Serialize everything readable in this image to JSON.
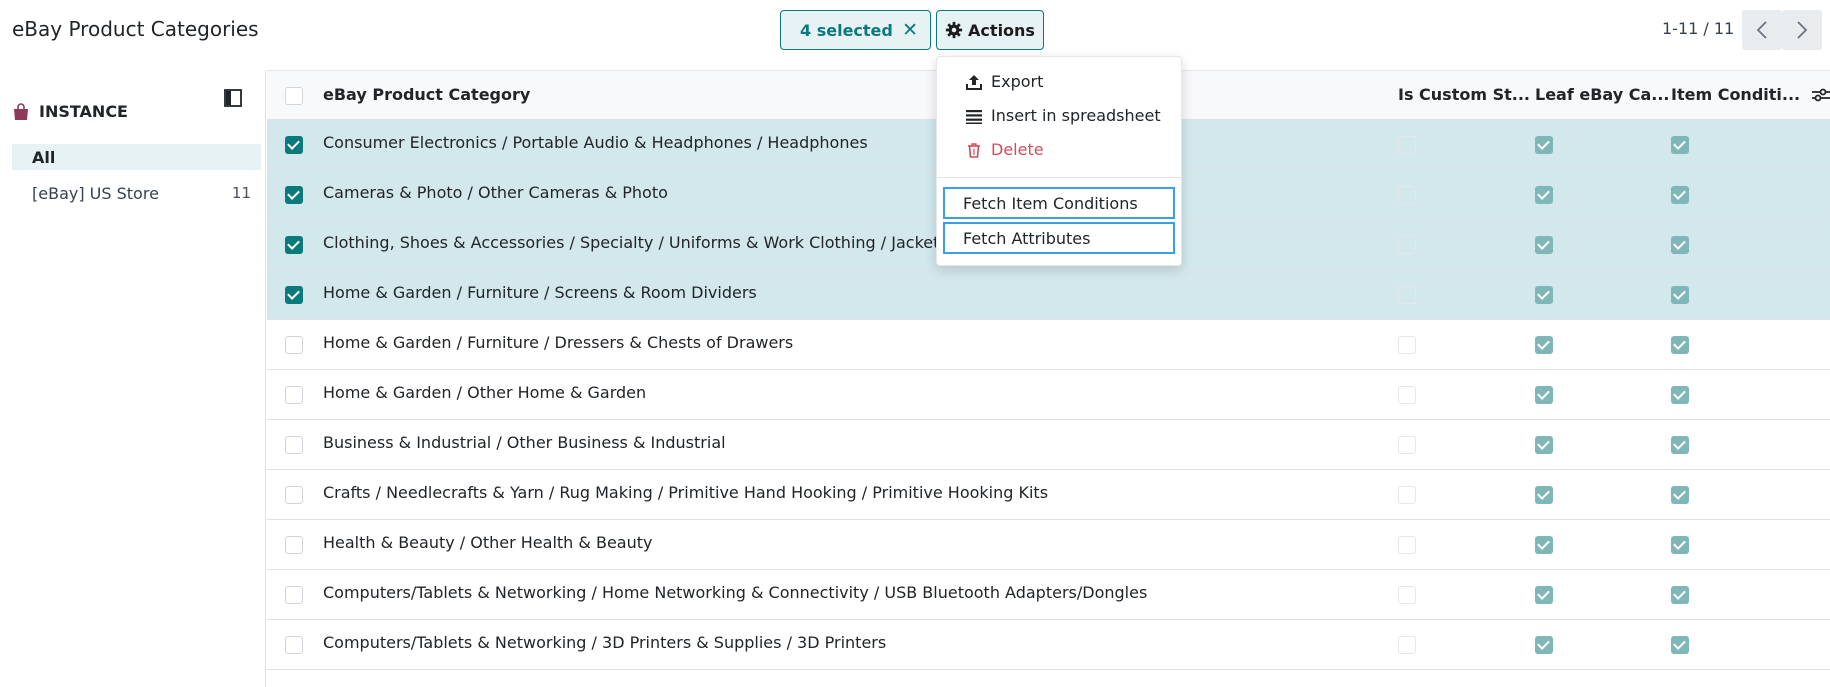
{
  "header": {
    "title": "eBay Product Categories",
    "selected_label": "4 selected",
    "actions_label": "Actions",
    "pager": "1-11 / 11"
  },
  "sidebar": {
    "section_title": "INSTANCE",
    "items": [
      {
        "label": "All",
        "count": ""
      },
      {
        "label": "[eBay] US Store",
        "count": "11"
      }
    ]
  },
  "table": {
    "columns": [
      "eBay Product Category",
      "Is Custom St...",
      "Leaf eBay Ca...",
      "Item Conditi..."
    ],
    "rows": [
      {
        "name": "Consumer Electronics / Portable Audio & Headphones / Headphones",
        "selected": true,
        "custom": false,
        "leaf": true,
        "condition": true
      },
      {
        "name": "Cameras & Photo / Other Cameras & Photo",
        "selected": true,
        "custom": false,
        "leaf": true,
        "condition": true
      },
      {
        "name": "Clothing, Shoes & Accessories / Specialty / Uniforms & Work Clothing / Jackets",
        "selected": true,
        "custom": false,
        "leaf": true,
        "condition": true
      },
      {
        "name": "Home & Garden / Furniture / Screens & Room Dividers",
        "selected": true,
        "custom": false,
        "leaf": true,
        "condition": true
      },
      {
        "name": "Home & Garden / Furniture / Dressers & Chests of Drawers",
        "selected": false,
        "custom": false,
        "leaf": true,
        "condition": true
      },
      {
        "name": "Home & Garden / Other Home & Garden",
        "selected": false,
        "custom": false,
        "leaf": true,
        "condition": true
      },
      {
        "name": "Business & Industrial / Other Business & Industrial",
        "selected": false,
        "custom": false,
        "leaf": true,
        "condition": true
      },
      {
        "name": "Crafts / Needlecrafts & Yarn / Rug Making / Primitive Hand Hooking / Primitive Hooking Kits",
        "selected": false,
        "custom": false,
        "leaf": true,
        "condition": true
      },
      {
        "name": "Health & Beauty / Other Health & Beauty",
        "selected": false,
        "custom": false,
        "leaf": true,
        "condition": true
      },
      {
        "name": "Computers/Tablets & Networking / Home Networking & Connectivity / USB Bluetooth Adapters/Dongles",
        "selected": false,
        "custom": false,
        "leaf": true,
        "condition": true
      },
      {
        "name": "Computers/Tablets & Networking / 3D Printers & Supplies / 3D Printers",
        "selected": false,
        "custom": false,
        "leaf": true,
        "condition": true
      }
    ]
  },
  "actions_menu": {
    "export": "Export",
    "insert": "Insert in spreadsheet",
    "delete": "Delete",
    "fetch_conditions": "Fetch Item Conditions",
    "fetch_attributes": "Fetch Attributes"
  },
  "colors": {
    "accent": "#0b7a7d",
    "selected_row": "#d2e8ec",
    "danger": "#d44c59",
    "focus_border": "#3b9fe6"
  }
}
